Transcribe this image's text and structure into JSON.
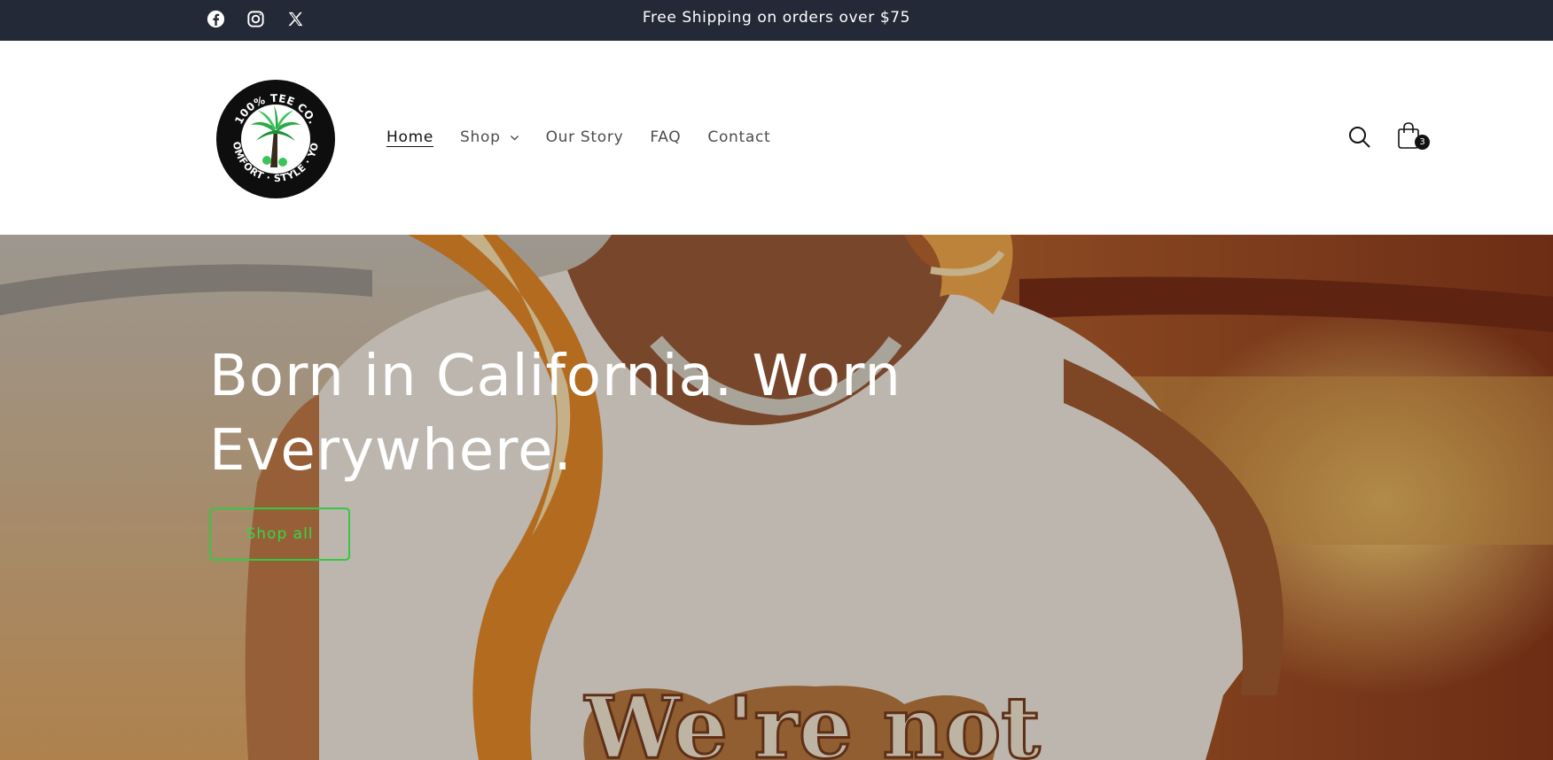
{
  "announcement": {
    "text": "Free Shipping on orders over $75",
    "background": "#232936",
    "social_icons": [
      "facebook-icon",
      "instagram-icon",
      "x-icon"
    ]
  },
  "header": {
    "logo": {
      "top_text": "100% TEE CO.",
      "bottom_text": "COMFORT · STYLE · YOU",
      "icon": "palm-tree-icon"
    },
    "nav": [
      {
        "label": "Home",
        "active": true
      },
      {
        "label": "Shop",
        "has_dropdown": true
      },
      {
        "label": "Our Story"
      },
      {
        "label": "FAQ"
      },
      {
        "label": "Contact"
      }
    ],
    "search_icon": "search-icon",
    "cart": {
      "icon": "shopping-bag-icon",
      "count": "3"
    }
  },
  "hero": {
    "heading": "Born in California. Worn Everywhere.",
    "button_label": "Shop all",
    "button_color": "#35d746",
    "shirt_text": "We're not"
  }
}
